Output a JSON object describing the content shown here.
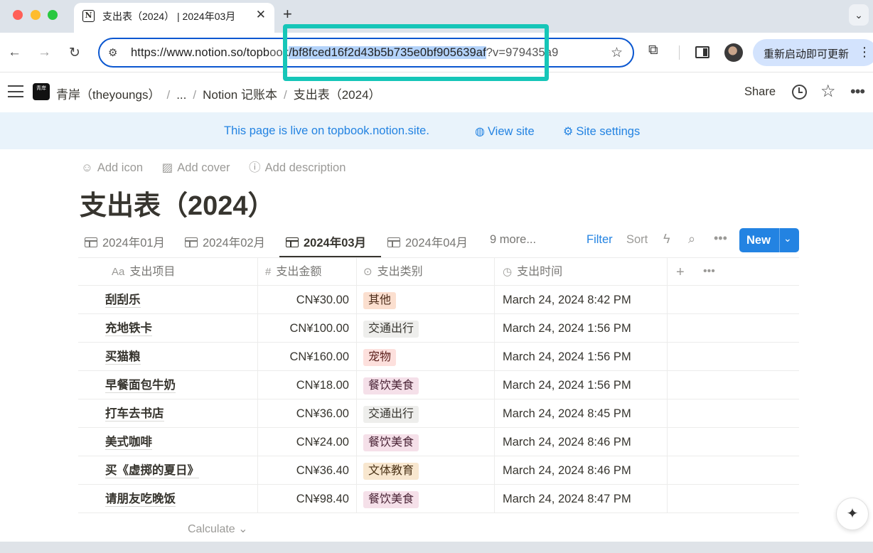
{
  "browser": {
    "tab_title": "支出表（2024） | 2024年03月",
    "favicon": "N",
    "url_prefix": "https://www.notion.so/topb",
    "url_mid_dim": "ook",
    "url_selected": "/bf8fced16f2d43b5b735e0bf905639af",
    "url_suffix": "?v=979435a9",
    "update_label": "重新启动即可更新",
    "profile_label": "profile-avatar"
  },
  "notion": {
    "workspace_icon": "青岸",
    "breadcrumbs": [
      "青岸（theyoungs）",
      "...",
      "Notion 记账本",
      "支出表（2024）"
    ],
    "share_label": "Share",
    "banner_text": "This page is live on topbook.notion.site.",
    "view_site": "View site",
    "site_settings": "Site settings",
    "page_actions": {
      "add_icon": "Add icon",
      "add_cover": "Add cover",
      "add_description": "Add description"
    },
    "page_title": "支出表（2024）",
    "views": [
      {
        "label": "2024年01月",
        "active": false
      },
      {
        "label": "2024年02月",
        "active": false
      },
      {
        "label": "2024年03月",
        "active": true
      },
      {
        "label": "2024年04月",
        "active": false
      }
    ],
    "more_views": "9 more...",
    "filter": "Filter",
    "sort": "Sort",
    "new_label": "New",
    "calculate": "Calculate"
  },
  "table": {
    "headers": {
      "name": "支出项目",
      "amount": "支出金额",
      "category": "支出类别",
      "time": "支出时间"
    },
    "header_icons": {
      "name": "Aa",
      "amount": "#"
    },
    "rows": [
      {
        "name": "刮刮乐",
        "amount": "CN¥30.00",
        "category": "其他",
        "time": "March 24, 2024 8:42 PM"
      },
      {
        "name": "充地铁卡",
        "amount": "CN¥100.00",
        "category": "交通出行",
        "time": "March 24, 2024 1:56 PM"
      },
      {
        "name": "买猫粮",
        "amount": "CN¥160.00",
        "category": "宠物",
        "time": "March 24, 2024 1:56 PM"
      },
      {
        "name": "早餐面包牛奶",
        "amount": "CN¥18.00",
        "category": "餐饮美食",
        "time": "March 24, 2024 1:56 PM"
      },
      {
        "name": "打车去书店",
        "amount": "CN¥36.00",
        "category": "交通出行",
        "time": "March 24, 2024 8:45 PM"
      },
      {
        "name": "美式咖啡",
        "amount": "CN¥24.00",
        "category": "餐饮美食",
        "time": "March 24, 2024 8:46 PM"
      },
      {
        "name": "买《虚掷的夏日》",
        "amount": "CN¥36.40",
        "category": "文体教育",
        "time": "March 24, 2024 8:46 PM"
      },
      {
        "name": "请朋友吃晚饭",
        "amount": "CN¥98.40",
        "category": "餐饮美食",
        "time": "March 24, 2024 8:47 PM"
      }
    ],
    "tag_colors": {
      "其他": {
        "bg": "#fbdfcf",
        "fg": "#4a2a18"
      },
      "交通出行": {
        "bg": "#eeeeec",
        "fg": "#37352f"
      },
      "宠物": {
        "bg": "#fde0dd",
        "fg": "#5a1e1a"
      },
      "餐饮美食": {
        "bg": "#f5e0e9",
        "fg": "#4a2436"
      },
      "文体教育": {
        "bg": "#f8e7cf",
        "fg": "#4a3216"
      }
    }
  },
  "colors": {
    "accent": "#2383e2",
    "highlight": "#16c6b8",
    "omnibox_border": "#0b57d0"
  }
}
